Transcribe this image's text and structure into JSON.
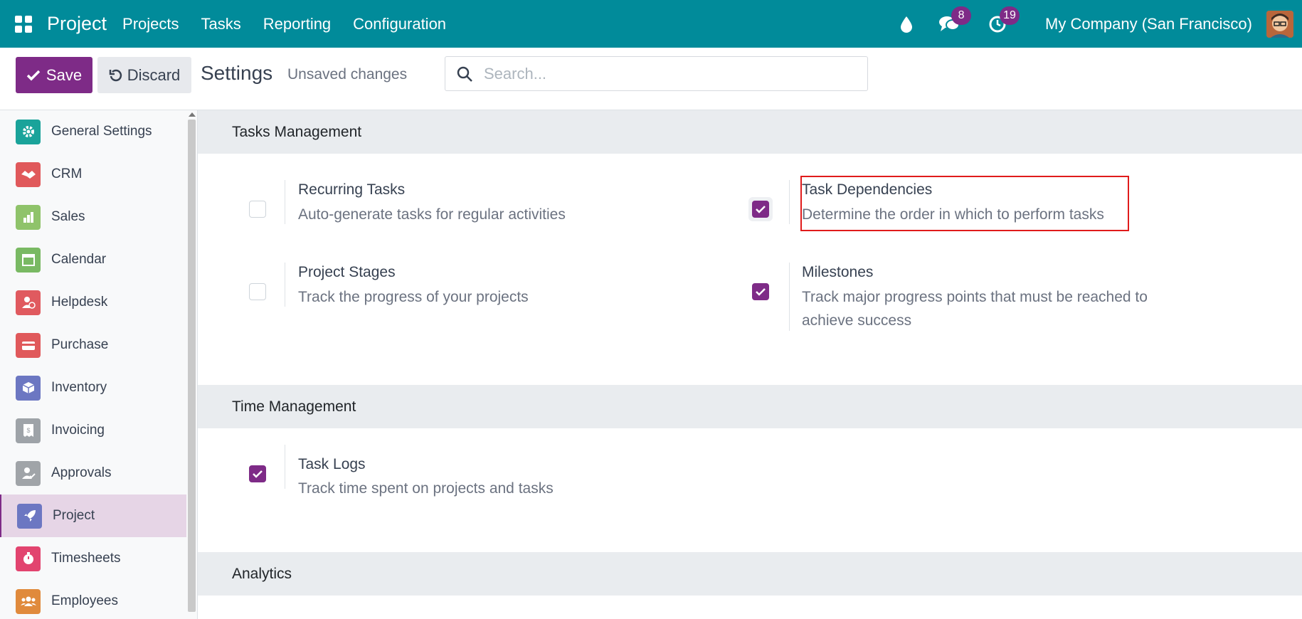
{
  "navbar": {
    "brand": "Project",
    "menus": [
      "Projects",
      "Tasks",
      "Reporting",
      "Configuration"
    ],
    "messages_badge": "8",
    "activities_badge": "19",
    "company": "My Company (San Francisco)"
  },
  "control": {
    "save_label": "Save",
    "discard_label": "Discard",
    "title": "Settings",
    "status": "Unsaved changes",
    "search_placeholder": "Search..."
  },
  "sidebar": {
    "items": [
      {
        "label": "General Settings",
        "icon": "gear-icon",
        "color": "#1aa39a"
      },
      {
        "label": "CRM",
        "icon": "handshake-icon",
        "color": "#e0595b"
      },
      {
        "label": "Sales",
        "icon": "chart-icon",
        "color": "#8fc36a"
      },
      {
        "label": "Calendar",
        "icon": "calendar-icon",
        "color": "#79b963"
      },
      {
        "label": "Helpdesk",
        "icon": "helpdesk-icon",
        "color": "#e05a5f"
      },
      {
        "label": "Purchase",
        "icon": "card-icon",
        "color": "#e0595b"
      },
      {
        "label": "Inventory",
        "icon": "box-icon",
        "color": "#6c77c2"
      },
      {
        "label": "Invoicing",
        "icon": "invoice-icon",
        "color": "#9ea3a8"
      },
      {
        "label": "Approvals",
        "icon": "approval-icon",
        "color": "#a0a4a8"
      },
      {
        "label": "Project",
        "icon": "rocket-icon",
        "color": "#6c77c2"
      },
      {
        "label": "Timesheets",
        "icon": "stopwatch-icon",
        "color": "#e2446f"
      },
      {
        "label": "Employees",
        "icon": "people-icon",
        "color": "#e08a3c"
      }
    ],
    "active": "Project"
  },
  "sections": {
    "tasks": {
      "title": "Tasks Management",
      "settings": [
        {
          "title": "Recurring Tasks",
          "desc": "Auto-generate tasks for regular activities",
          "checked": false
        },
        {
          "title": "Task Dependencies",
          "desc": "Determine the order in which to perform tasks",
          "checked": true
        },
        {
          "title": "Project Stages",
          "desc": "Track the progress of your projects",
          "checked": false
        },
        {
          "title": "Milestones",
          "desc": "Track major progress points that must be reached to achieve success",
          "checked": true
        }
      ]
    },
    "time": {
      "title": "Time Management",
      "settings": [
        {
          "title": "Task Logs",
          "desc": "Track time spent on projects and tasks",
          "checked": true
        }
      ]
    },
    "analytics": {
      "title": "Analytics"
    }
  },
  "colors": {
    "navbar": "#018b9a",
    "primary": "#7e2b87",
    "highlight": "#e01b1b"
  }
}
